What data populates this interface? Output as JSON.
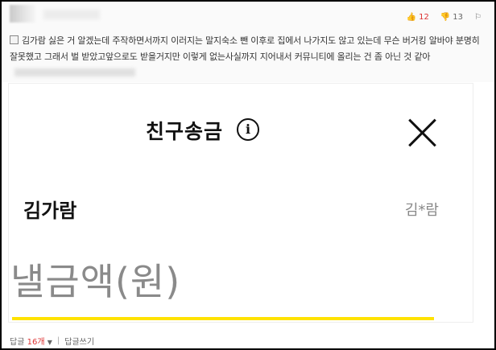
{
  "votes": {
    "up_count": "12",
    "down_count": "13"
  },
  "comment": {
    "text": "김가람 싫은 거 알겠는데 주작하면서까지 이러지는 말지숙소 뺀 이후로 집에서 나가지도 않고 있는데 무슨 버거킹 알바야 분명히 잘못했고 그래서 벌 받았고앞으로도 받을거지만 이렇게 없는사실까지 지어내서 커뮤니티에 올리는 건 좀 아닌 것 같아"
  },
  "screenshot": {
    "title": "친구송금",
    "info_symbol": "i",
    "recipient_name": "김가람",
    "recipient_masked": "김*람",
    "amount_placeholder": "낼금액(원)"
  },
  "footer": {
    "reply_label": "답글",
    "reply_count": "16개",
    "write_reply_label": "답글쓰기"
  }
}
